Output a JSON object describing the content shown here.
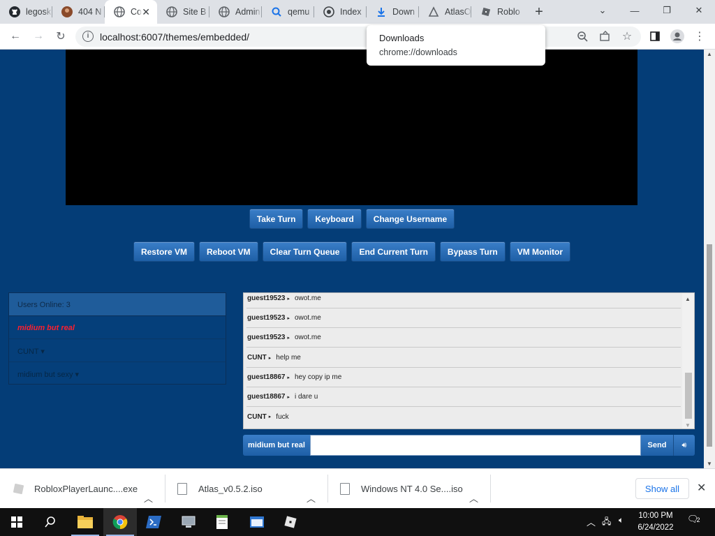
{
  "browser": {
    "tabs": [
      {
        "title": "legosk",
        "icon": "github-icon"
      },
      {
        "title": "404 N",
        "icon": "avatar-favicon"
      },
      {
        "title": "Co",
        "icon": "globe-icon",
        "active": true
      },
      {
        "title": "Site B",
        "icon": "globe-icon"
      },
      {
        "title": "Admin",
        "icon": "globe-icon"
      },
      {
        "title": "qemu",
        "icon": "search-favicon"
      },
      {
        "title": "Index",
        "icon": "github-icon"
      },
      {
        "title": "Down",
        "icon": "download-icon"
      },
      {
        "title": "AtlasO",
        "icon": "atlas-icon"
      },
      {
        "title": "Roblo",
        "icon": "roblox-icon"
      }
    ],
    "url": "localhost:6007/themes/embedded/",
    "popup": {
      "title": "Downloads",
      "url": "chrome://downloads"
    }
  },
  "vm": {
    "row1": [
      "Take Turn",
      "Keyboard",
      "Change Username"
    ],
    "row2": [
      "Restore VM",
      "Reboot VM",
      "Clear Turn Queue",
      "End Current Turn",
      "Bypass Turn",
      "VM Monitor"
    ]
  },
  "users": {
    "header": "Users Online: 3",
    "list": [
      "midium but real",
      "CUNT ▾",
      "midium but sexy ▾"
    ]
  },
  "chat": {
    "messages": [
      {
        "user": "guest19523",
        "text": "owot.me"
      },
      {
        "user": "guest19523",
        "text": "owot.me"
      },
      {
        "user": "guest19523",
        "text": "owot.me"
      },
      {
        "user": "CUNT",
        "text": "help me"
      },
      {
        "user": "guest18867",
        "text": "hey copy ip me"
      },
      {
        "user": "guest18867",
        "text": "i dare u"
      },
      {
        "user": "CUNT",
        "text": "fuck"
      }
    ],
    "username": "midium but real",
    "send_label": "Send"
  },
  "downloads": {
    "items": [
      "RobloxPlayerLaunc....exe",
      "Atlas_v0.5.2.iso",
      "Windows NT 4.0 Se....iso"
    ],
    "show_all": "Show all"
  },
  "taskbar": {
    "time": "10:00 PM",
    "date": "6/24/2022",
    "notifications": "2"
  },
  "colors": {
    "page_bg": "#043d77",
    "button": "#2a6db5",
    "highlight_user": "#ff1f2e"
  }
}
